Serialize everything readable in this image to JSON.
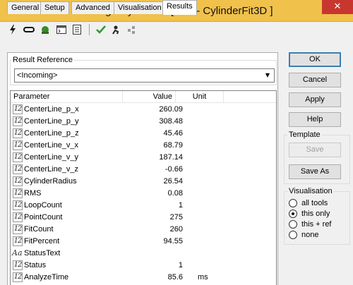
{
  "window": {
    "title": "Change Cylinder 1 [ 112 - CylinderFit3D ]",
    "close_glyph": "✕"
  },
  "toolbar": {
    "icons": [
      "lightning-icon",
      "link-icon",
      "plugin-icon",
      "console-icon",
      "list-icon",
      "check-icon",
      "run-icon",
      "arrange-icon"
    ]
  },
  "tabs": [
    {
      "label": "General",
      "active": false
    },
    {
      "label": "Setup",
      "active": false
    },
    {
      "label": "Advanced",
      "active": false
    },
    {
      "label": "Visualisation",
      "active": false
    },
    {
      "label": "Results",
      "active": true
    }
  ],
  "result_reference": {
    "label": "Result Reference",
    "value": "<Incoming>"
  },
  "table": {
    "columns": [
      "Parameter",
      "Value",
      "Unit"
    ],
    "rows": [
      {
        "type": "int",
        "name": "CenterLine_p_x",
        "value": "260.09",
        "unit": ""
      },
      {
        "type": "int",
        "name": "CenterLine_p_y",
        "value": "308.48",
        "unit": ""
      },
      {
        "type": "int",
        "name": "CenterLine_p_z",
        "value": "45.46",
        "unit": ""
      },
      {
        "type": "int",
        "name": "CenterLine_v_x",
        "value": "68.79",
        "unit": ""
      },
      {
        "type": "int",
        "name": "CenterLine_v_y",
        "value": "187.14",
        "unit": ""
      },
      {
        "type": "int",
        "name": "CenterLine_v_z",
        "value": "-0.66",
        "unit": ""
      },
      {
        "type": "int",
        "name": "CylinderRadius",
        "value": "26.54",
        "unit": ""
      },
      {
        "type": "int",
        "name": "RMS",
        "value": "0.08",
        "unit": ""
      },
      {
        "type": "int",
        "name": "LoopCount",
        "value": "1",
        "unit": ""
      },
      {
        "type": "int",
        "name": "PointCount",
        "value": "275",
        "unit": ""
      },
      {
        "type": "int",
        "name": "FitCount",
        "value": "260",
        "unit": ""
      },
      {
        "type": "int",
        "name": "FitPercent",
        "value": "94.55",
        "unit": ""
      },
      {
        "type": "str",
        "name": "StatusText",
        "value": "",
        "unit": ""
      },
      {
        "type": "int",
        "name": "Status",
        "value": "1",
        "unit": ""
      },
      {
        "type": "int",
        "name": "AnalyzeTime",
        "value": "85.6",
        "unit": "ms"
      }
    ]
  },
  "type_icons": {
    "int": "12",
    "str": "Aa"
  },
  "buttons": {
    "ok": "OK",
    "cancel": "Cancel",
    "apply": "Apply",
    "help": "Help"
  },
  "template": {
    "label": "Template",
    "save": "Save",
    "save_as": "Save As"
  },
  "visualisation": {
    "label": "Visualisation",
    "options": [
      {
        "label": "all tools",
        "selected": false
      },
      {
        "label": "this only",
        "selected": true
      },
      {
        "label": "this + ref",
        "selected": false
      },
      {
        "label": "none",
        "selected": false
      }
    ]
  }
}
